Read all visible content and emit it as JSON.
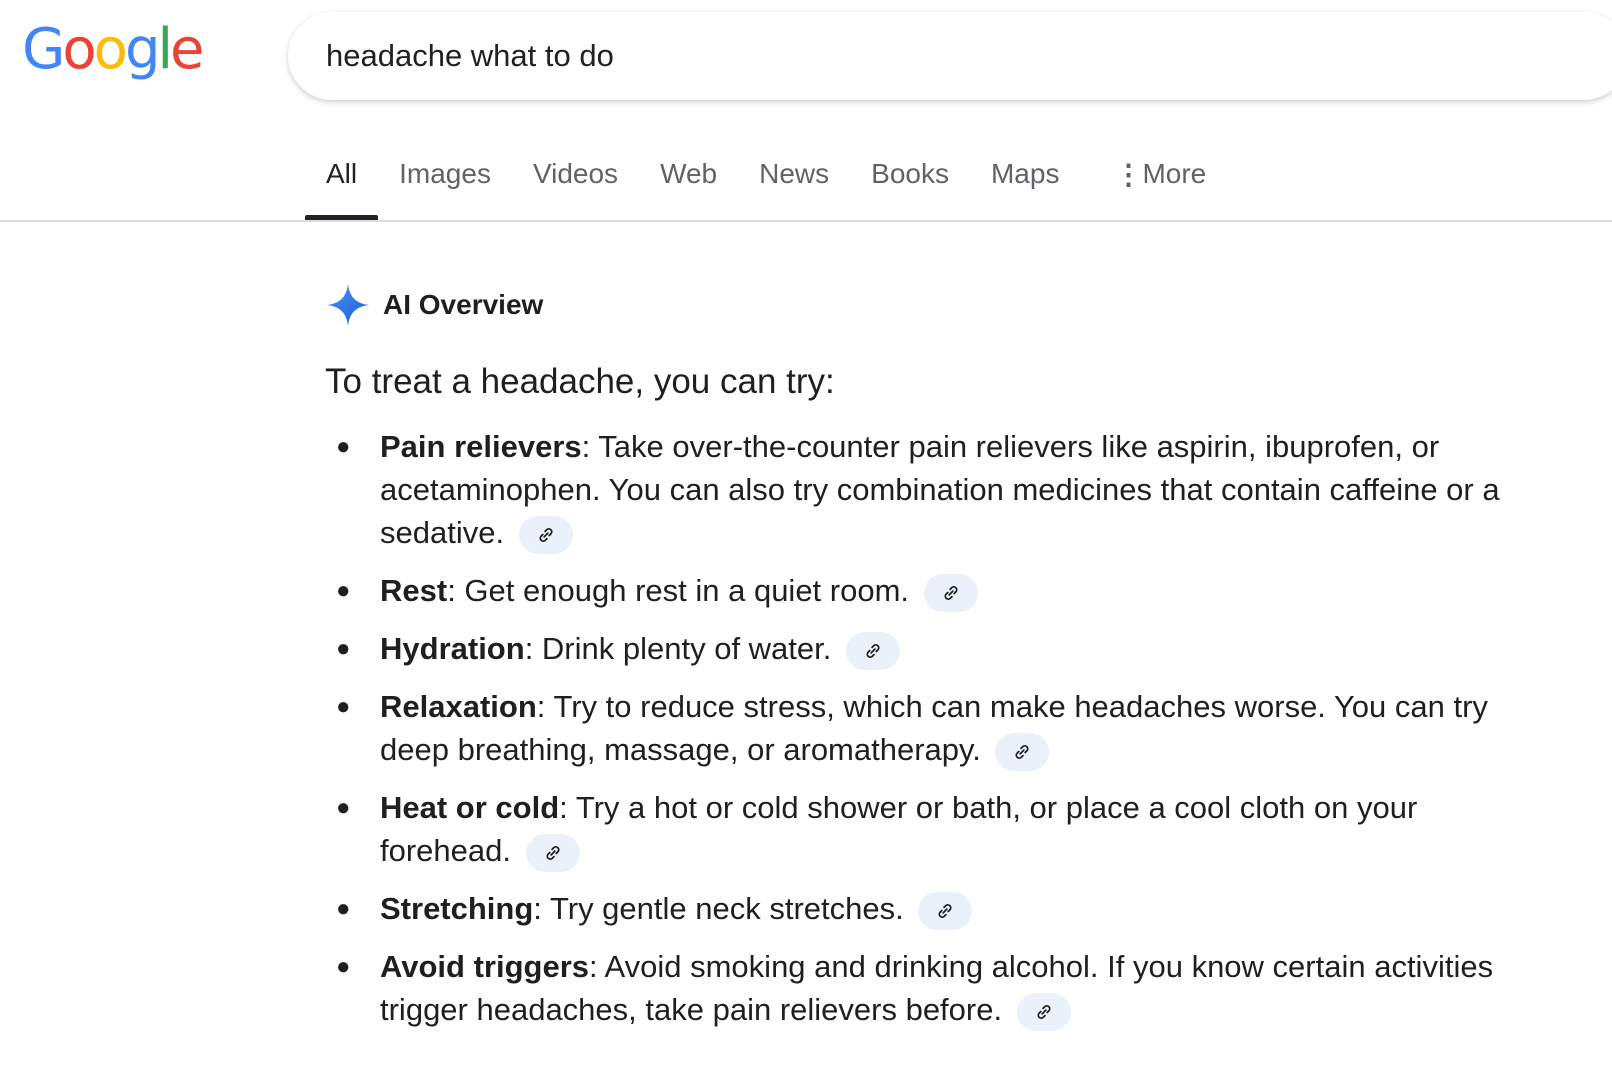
{
  "logo": {
    "letters": [
      {
        "char": "G",
        "color": "#4285F4"
      },
      {
        "char": "o",
        "color": "#EA4335"
      },
      {
        "char": "o",
        "color": "#FBBC05"
      },
      {
        "char": "g",
        "color": "#4285F4"
      },
      {
        "char": "l",
        "color": "#34A853"
      },
      {
        "char": "e",
        "color": "#EA4335"
      }
    ]
  },
  "search": {
    "value": "headache what to do"
  },
  "tabs": [
    {
      "label": "All",
      "active": true
    },
    {
      "label": "Images"
    },
    {
      "label": "Videos"
    },
    {
      "label": "Web"
    },
    {
      "label": "News"
    },
    {
      "label": "Books"
    },
    {
      "label": "Maps"
    }
  ],
  "more": {
    "label": "More",
    "icon": "vertical-dots-icon"
  },
  "ai_overview": {
    "title": "AI Overview",
    "icon": "gemini-sparkle-icon",
    "intro": "To treat a headache, you can try:",
    "items": [
      {
        "term": "Pain relievers",
        "text": ": Take over-the-counter pain relievers like aspirin, ibuprofen, or acetaminophen. You can also try combination medicines that contain caffeine or a sedative."
      },
      {
        "term": "Rest",
        "text": ": Get enough rest in a quiet room."
      },
      {
        "term": "Hydration",
        "text": ": Drink plenty of water."
      },
      {
        "term": "Relaxation",
        "text": ": Try to reduce stress, which can make headaches worse. You can try deep breathing, massage, or aromatherapy."
      },
      {
        "term": "Heat or cold",
        "text": ": Try a hot or cold shower or bath, or place a cool cloth on your forehead."
      },
      {
        "term": "Stretching",
        "text": ": Try gentle neck stretches."
      },
      {
        "term": "Avoid triggers",
        "text": ": Avoid smoking and drinking alcohol. If you know certain activities trigger headaches, take pain relievers before."
      }
    ],
    "citation_icon": "link-icon"
  },
  "colors": {
    "accent_blue": "#1a73e8",
    "citation_bg": "#eaf1fb",
    "text": "#1f1f1f",
    "tab_inactive": "#5f6368"
  }
}
